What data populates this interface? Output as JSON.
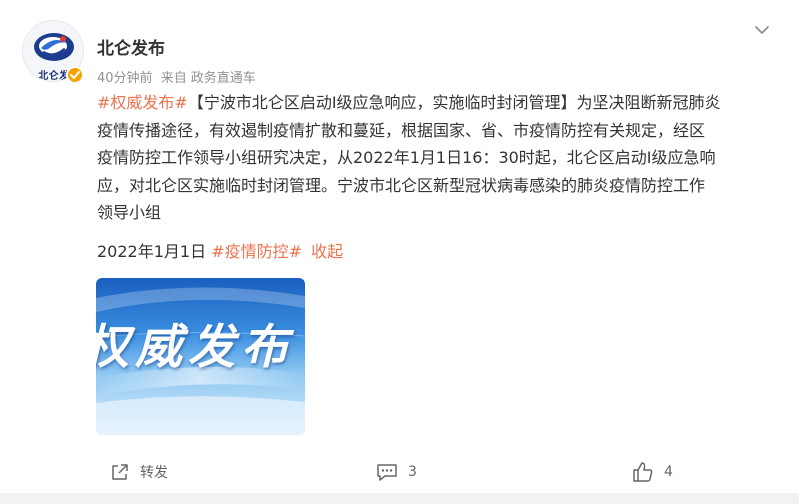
{
  "post": {
    "author": "北仑发布",
    "avatar_text": "北仑发",
    "time": "40分钟前",
    "source_prefix": "来自",
    "source": "政务直通车",
    "lines": [
      {
        "topic": "#权威发布#",
        "text": "【宁波市北仑区启动I级应急响应，实施临时封闭管理】为坚决阻断新冠肺炎"
      },
      {
        "text": "疫情传播途径，有效遏制疫情扩散和蔓延，根据国家、省、市疫情防控有关规定，经区"
      },
      {
        "text": "疫情防控工作领导小组研究决定，从2022年1月1日16：30时起，北仑区启动I级应急响"
      },
      {
        "text": "应，对北仑区实施临时封闭管理。宁波市北仑区新型冠状病毒感染的肺炎疫情防控工作"
      },
      {
        "text": "领导小组"
      }
    ],
    "date": "2022年1月1日",
    "topic2": "#疫情防控#",
    "collapse": "收起",
    "image_text": "权威发布"
  },
  "actions": {
    "repost_label": "转发",
    "comment_count": "3",
    "like_count": "4"
  },
  "colors": {
    "topic": "#eb7350",
    "verified": "#f7a200",
    "image_blue": "#2a7fd4"
  },
  "icons": {
    "more": "chevron-down-icon",
    "repost": "share-icon",
    "comment": "comment-icon",
    "like": "thumbs-up-icon"
  }
}
